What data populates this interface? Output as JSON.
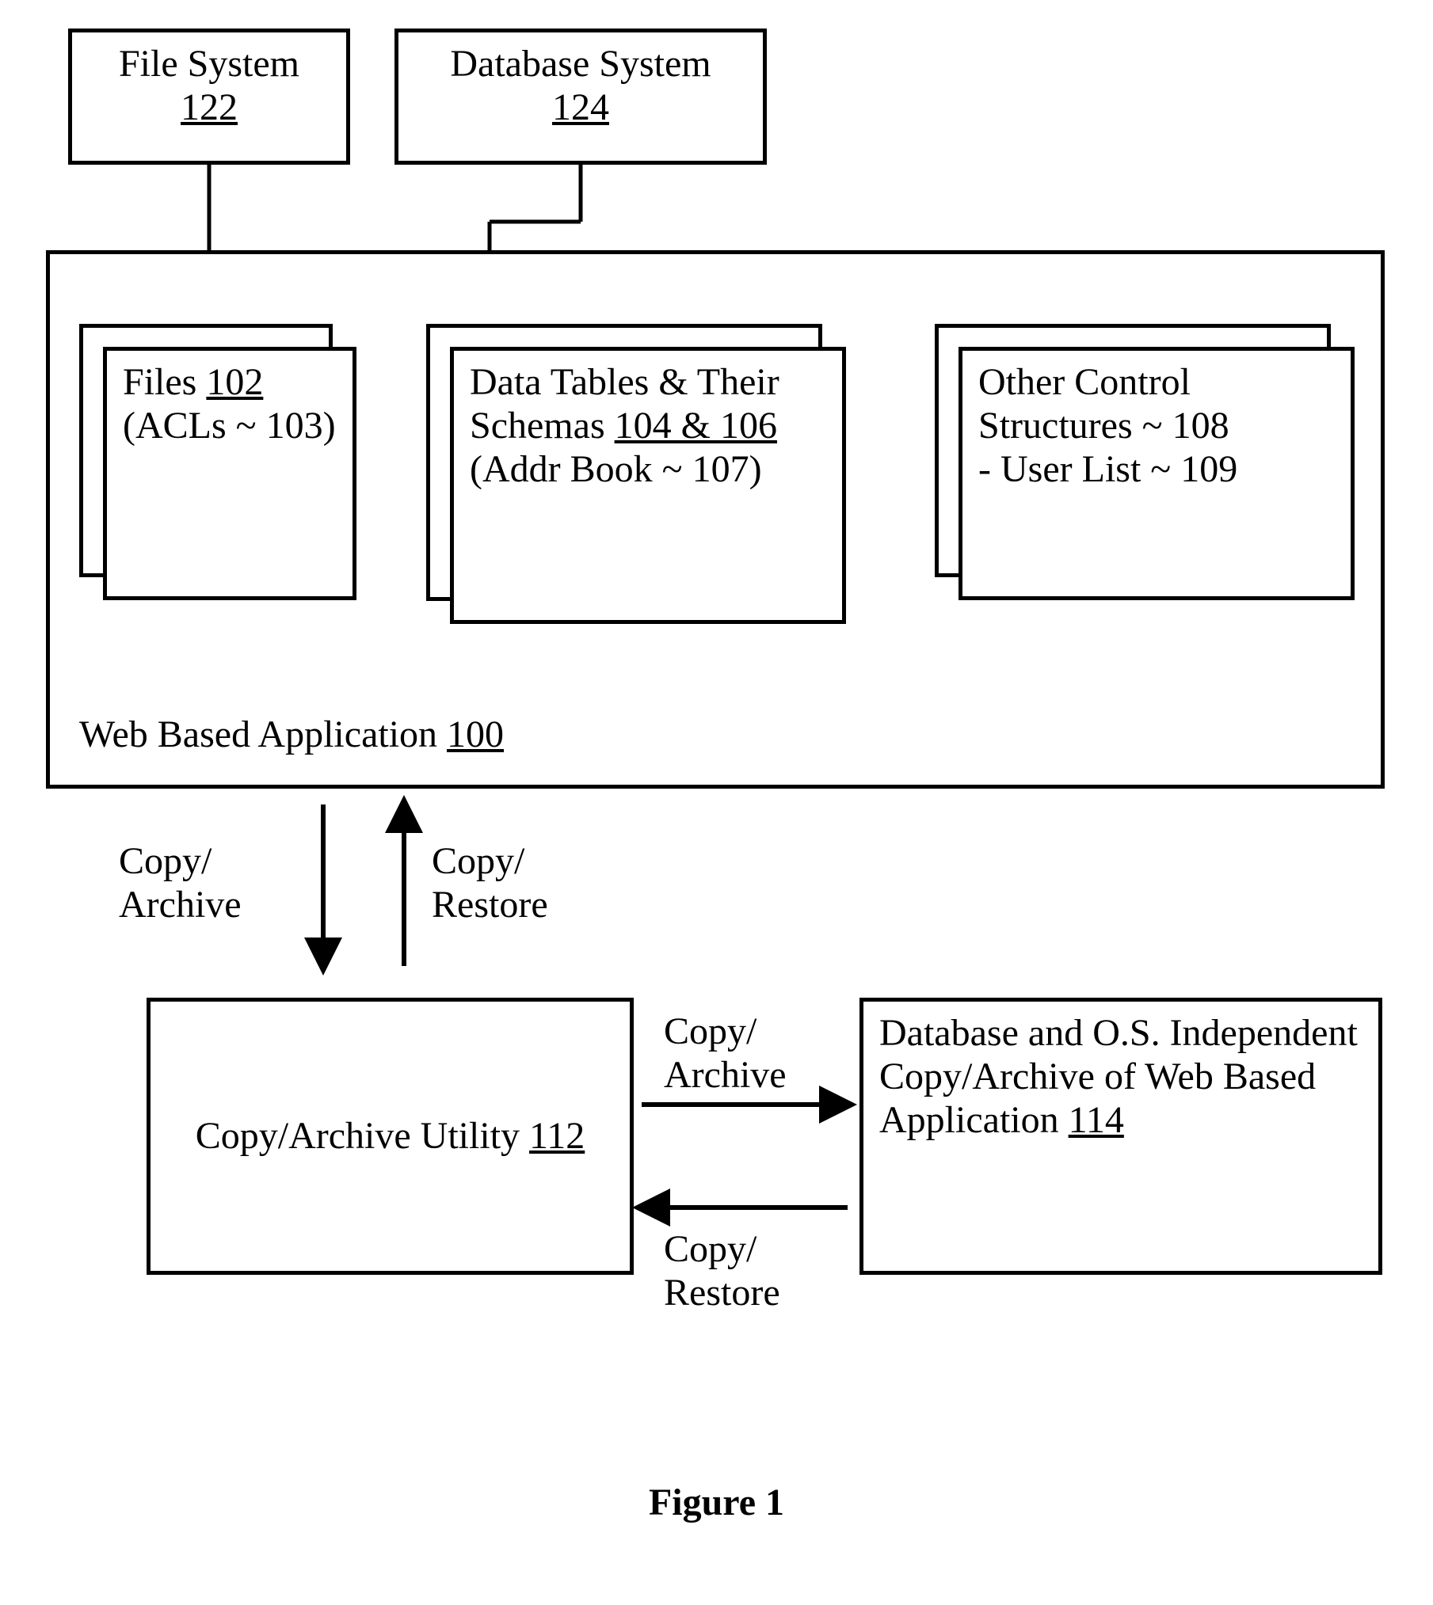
{
  "fileSystem": {
    "title": "File System",
    "ref": "122"
  },
  "databaseSystem": {
    "title": "Database System",
    "ref": "124"
  },
  "webApp": {
    "label_prefix": "Web Based Application ",
    "ref": "100"
  },
  "files": {
    "title_prefix": "Files ",
    "ref": "102",
    "acl_line": "(ACLs ~ 103)"
  },
  "dataTables": {
    "title": "Data Tables & Their Schemas ",
    "refs": "104 & 106",
    "addr_line": "(Addr Book ~ 107)"
  },
  "otherCtl": {
    "line1": "Other Control Structures ~ 108",
    "line2": "- User List ~ 109"
  },
  "arrows": {
    "copy_archive": "Copy/\nArchive",
    "copy_restore": "Copy/\nRestore"
  },
  "utility": {
    "title": "Copy/Archive Utility ",
    "ref": "112"
  },
  "archive": {
    "text": "Database and O.S. Independent Copy/Archive of Web Based Application ",
    "ref": "114"
  },
  "figure": "Figure 1"
}
